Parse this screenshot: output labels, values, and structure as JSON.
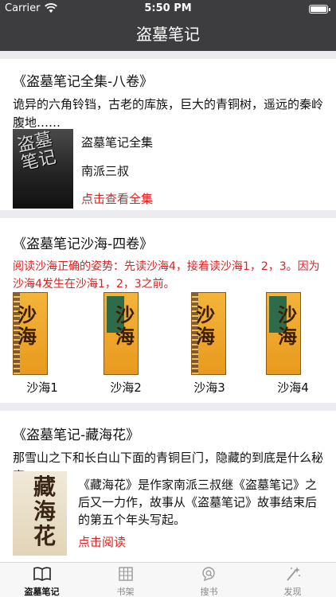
{
  "status_bar": {
    "carrier": "Carrier",
    "time": "5:50 PM"
  },
  "nav": {
    "title": "盗墓笔记"
  },
  "sections": {
    "complete": {
      "title": "《盗墓笔记全集-八卷》",
      "desc": "诡异的六角铃铛，古老的库族，巨大的青铜树，遥远的秦岭腹地……",
      "cover_text": "盗墓笔记",
      "book_name": "盗墓笔记全集",
      "author": "南派三叔",
      "link": "点击查看全集"
    },
    "shahai": {
      "title": "《盗墓笔记沙海-四卷》",
      "note": "阅读沙海正确的姿势：先读沙海4，接着读沙海1，2，3。因为沙海4发生在沙海1，2，3之前。",
      "cover_text": "沙海",
      "books": [
        "沙海1",
        "沙海2",
        "沙海3",
        "沙海4"
      ]
    },
    "canghaihua": {
      "title": "《盗墓笔记-藏海花》",
      "desc": "那雪山之下和长白山下面的青铜巨门，隐藏的到底是什么秘密…….",
      "cover_text": "藏海花",
      "summary": "《藏海花》是作家南派三叔继《盗墓笔记》之后又一力作，故事从《盗墓笔记》故事结束后的第五个年头写起。",
      "link": "点击阅读"
    }
  },
  "tabs": [
    {
      "label": "盗墓笔记",
      "icon": "book-open-icon",
      "active": true
    },
    {
      "label": "书架",
      "icon": "bookshelf-icon",
      "active": false
    },
    {
      "label": "搜书",
      "icon": "search-icon",
      "active": false
    },
    {
      "label": "发现",
      "icon": "magic-wand-icon",
      "active": false
    }
  ],
  "colors": {
    "bar": "#3d3d3f",
    "accent_red": "#e02020",
    "background": "#ecebef"
  }
}
